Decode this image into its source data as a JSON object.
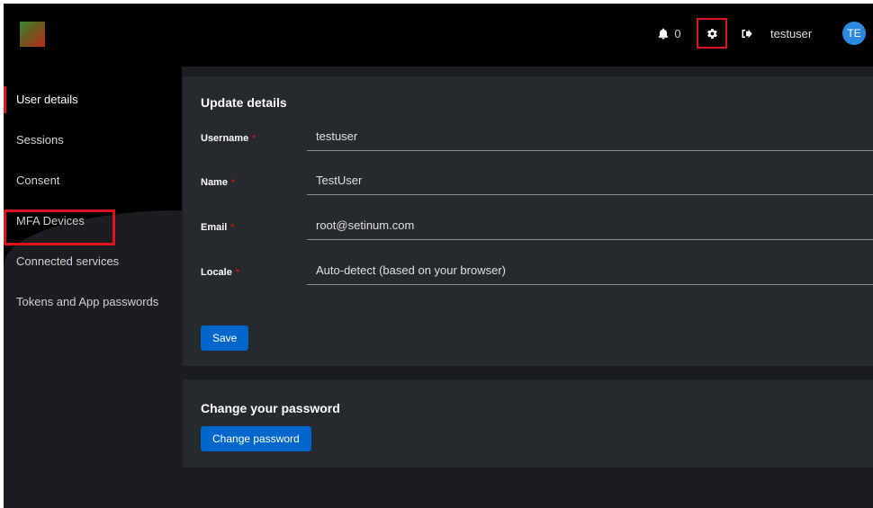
{
  "header": {
    "notifications_count": "0",
    "username": "testuser",
    "avatar_initials": "TE"
  },
  "sidebar": {
    "items": [
      {
        "label": "User details",
        "active": true
      },
      {
        "label": "Sessions"
      },
      {
        "label": "Consent"
      },
      {
        "label": "MFA Devices"
      },
      {
        "label": "Connected services"
      },
      {
        "label": "Tokens and App passwords"
      }
    ]
  },
  "update_details": {
    "title": "Update details",
    "fields": [
      {
        "label": "Username",
        "value": "testuser"
      },
      {
        "label": "Name",
        "value": "TestUser"
      },
      {
        "label": "Email",
        "value": "root@setinum.com"
      },
      {
        "label": "Locale",
        "value": "Auto-detect (based on your browser)"
      }
    ],
    "required_marker": "*",
    "save_label": "Save"
  },
  "change_password": {
    "title": "Change your password",
    "button_label": "Change password"
  },
  "colors": {
    "accent": "#0066cc",
    "highlight": "#e0141b",
    "topbar": "#000000",
    "card": "#26292d"
  },
  "icons": [
    "logo",
    "bell-icon",
    "gear-icon",
    "logout-icon"
  ]
}
